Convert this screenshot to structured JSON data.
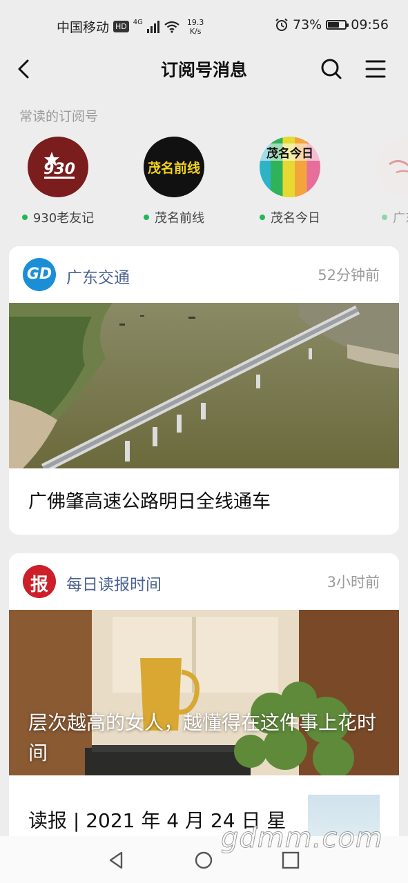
{
  "status_bar": {
    "carrier": "中国移动",
    "hd": "HD",
    "network": "4G",
    "speed_value": "19.3",
    "speed_unit": "K/s",
    "battery_percent": "73%",
    "battery_level": 0.73,
    "time": "09:56"
  },
  "nav": {
    "title": "订阅号消息",
    "back_icon": "chevron-left-icon",
    "search_icon": "search-icon",
    "menu_icon": "menu-icon"
  },
  "frequent": {
    "label": "常读的订阅号",
    "items": [
      {
        "name": "930老友记",
        "logo_text": "930"
      },
      {
        "name": "茂名前线",
        "logo_text": "茂名前线"
      },
      {
        "name": "茂名今日",
        "logo_text": "茂名今日"
      },
      {
        "name": "广东台",
        "logo_text": ""
      }
    ]
  },
  "cards": [
    {
      "source": "广东交通",
      "logo_text": "GD",
      "time": "52分钟前",
      "title": "广佛肇高速公路明日全线通车"
    },
    {
      "source": "每日读报时间",
      "logo_text": "报",
      "time": "3小时前",
      "title": "层次越高的女人，越懂得在这件事上花时间",
      "sub_item": "读报 | 2021 年 4 月 24 日 星"
    }
  ],
  "watermark": "gdmm.com",
  "colors": {
    "accent_blue": "#4a6290",
    "online_green": "#23b55c",
    "background": "#ededed"
  }
}
